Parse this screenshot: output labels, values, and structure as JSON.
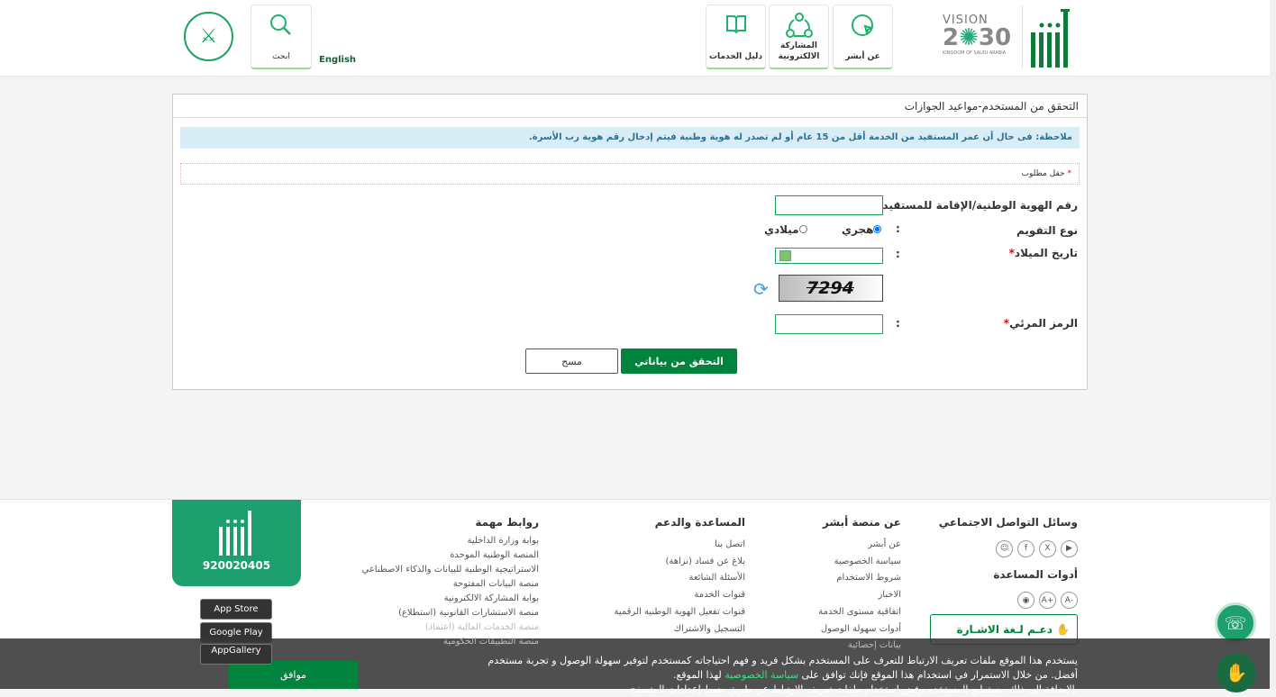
{
  "header": {
    "nav": [
      {
        "label": "عن أبشر",
        "icon": "cursor-icon"
      },
      {
        "label": "المشاركة الالكترونية",
        "icon": "share-icon"
      },
      {
        "label": "دليل الخدمات",
        "icon": "book-icon"
      }
    ],
    "search_label": "ابحث",
    "language": "English",
    "logo_vision": "VISION 2030",
    "logo_kingdom": "KINGDOM OF SAUDI ARABIA",
    "logo_absher": "أبشر"
  },
  "form": {
    "title": "التحقق من المستخدم-مواعيد الجوازات",
    "note": "ملاحظة: فى حال أن عمر المستفيد من الخدمة أقل من 15 عام أو لم تصدر له هوية وطنية فيتم إدخال رقم هوية رب الأسرة.",
    "required_note": "حقل مطلوب",
    "id_label": "رقم الهوية الوطنية/الإقامة للمستفيد",
    "calendar_label": "نوع التقويم",
    "hijri": "هجري",
    "gregorian": "ميلادي",
    "calendar_selected": "هجري",
    "dob_label": "تاريخ الميلاد",
    "captcha_text": "7294",
    "captcha_label": "الرمز المرئي",
    "submit": "التحقق من بياناتي",
    "clear": "مسح",
    "id_value": "",
    "dob_value": "",
    "captcha_value": ""
  },
  "footer": {
    "social_title": "وسائل التواصل الاجتماعي",
    "tools_title": "أدوات المساعدة",
    "sign_language": "دعـم لـغة الاشـارة",
    "about": {
      "title": "عن منصة أبشر",
      "links": [
        "عن أبشر",
        "سياسة الخصوصية",
        "شروط الاستخدام",
        "الاخبار",
        "اتفاقية مستوى الخدمة",
        "أدوات سهولة الوصول",
        "بيانات إحصائية"
      ]
    },
    "support": {
      "title": "المساعدة والدعم",
      "links": [
        "اتصل بنا",
        "بلاغ عن فساد (نزاهة)",
        "الأسئلة الشائعة",
        "قنوات الخدمة",
        "قنوات تفعيل الهوية الوطنية الرقمية",
        "التسجيل والاشتراك"
      ]
    },
    "links": {
      "title": "روابط مهمة",
      "links": [
        "بوابة وزارة الداخلية",
        "المنصة الوطنية الموحدة",
        "الاستراتيجية الوطنية للبيانات والذكاء الاصطناعي",
        "منصة البيانات المفتوحة",
        "بوابة المشاركة الالكترونية",
        "منصة الاستشارات القانونية (استطلاع)",
        "منصة الخدمات المالية (اعتماد)",
        "منصة التطبيقات الحكومية"
      ]
    },
    "phone": "920020405",
    "stores": [
      "App Store",
      "Google Play",
      "AppGallery"
    ],
    "font_minus": "-A",
    "font_plus": "+A"
  },
  "cookie": {
    "line1": "يستخدم هذا الموقع ملفات تعريف الارتباط للتعرف على المستخدم بشكل فريد و فهم احتياجاته كمستخدم لتوفير سهولة الوصول و تجربة مستخدم",
    "line2a": "أفضل. من خلال الاستمرار في استخدام هذا الموقع فإنك توافق على ",
    "privacy": "سياسة الخصوصية",
    "line2b": " لهذا الموقع.",
    "line3": "بالإضافة إلى ذلك، يستطيع المستخدم رفض استخدام ملفات تعريف الارتباط عن طريق ضبط إعدادات المتصفح",
    "accept": "موافق"
  },
  "colors": {
    "primary": "#00843d",
    "accent": "#1da06e",
    "note_bg": "#d9edf7"
  }
}
